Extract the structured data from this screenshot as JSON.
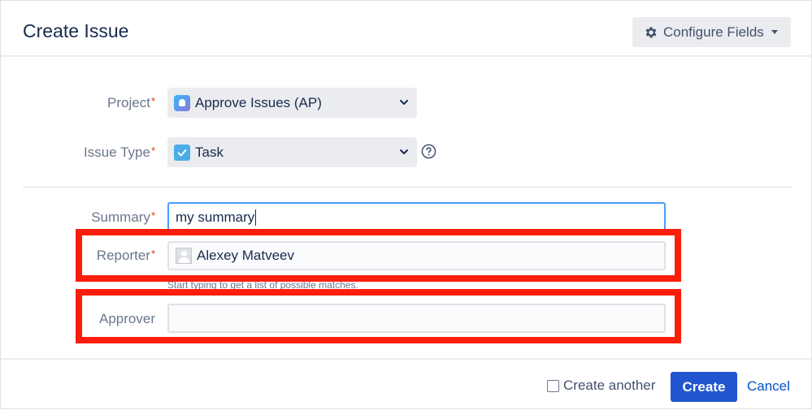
{
  "dialog": {
    "title": "Create Issue",
    "configure_fields_label": "Configure Fields"
  },
  "fields": {
    "project": {
      "label": "Project",
      "required_mark": "*",
      "value": "Approve Issues (AP)"
    },
    "issue_type": {
      "label": "Issue Type",
      "required_mark": "*",
      "value": "Task"
    },
    "summary": {
      "label": "Summary",
      "required_mark": "*",
      "value": "my summary"
    },
    "reporter": {
      "label": "Reporter",
      "required_mark": "*",
      "value": "Alexey Matveev",
      "hint": "Start typing to get a list of possible matches."
    },
    "approver": {
      "label": "Approver",
      "value": ""
    }
  },
  "footer": {
    "create_another_label": "Create another",
    "create_label": "Create",
    "cancel_label": "Cancel"
  },
  "colors": {
    "primary_button": "#2155cf",
    "highlight_box": "#fa1e0a",
    "required_mark": "#de350b",
    "link": "#0052cc"
  },
  "icons": [
    "gear-icon",
    "caret-down-icon",
    "project-avatar-icon",
    "task-checkbox-icon",
    "chevron-down-icon",
    "help-icon",
    "user-avatar-icon"
  ]
}
